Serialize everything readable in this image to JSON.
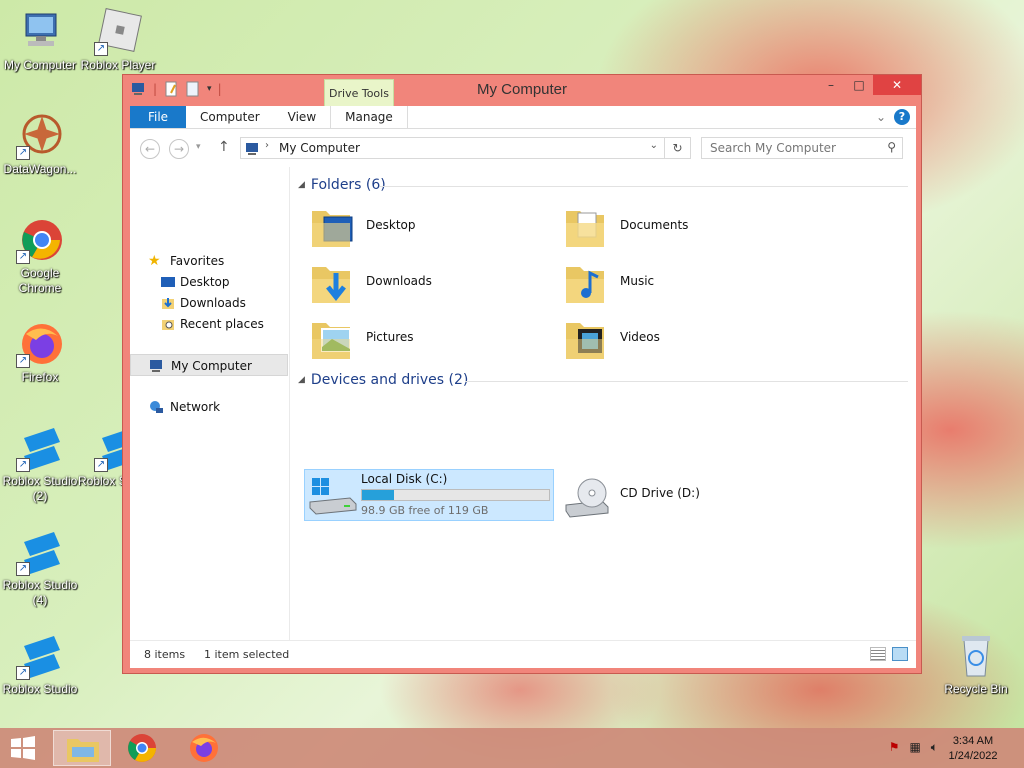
{
  "desktop": {
    "icons": [
      {
        "label": "My Computer"
      },
      {
        "label": "Roblox Player"
      },
      {
        "label": "DataWagon..."
      },
      {
        "label": "Google Chrome"
      },
      {
        "label": "Firefox"
      },
      {
        "label": "Roblox Studio (2)"
      },
      {
        "label": "Roblox S... (3)"
      },
      {
        "label": "Roblox Studio (4)"
      },
      {
        "label": "Roblox Studio"
      },
      {
        "label": "Recycle Bin"
      }
    ]
  },
  "window": {
    "title": "My Computer",
    "contextual_tab": "Drive Tools",
    "tabs": [
      "File",
      "Computer",
      "View",
      "Manage"
    ],
    "address": "My Computer",
    "search_placeholder": "Search My Computer",
    "nav": {
      "favorites": "Favorites",
      "desktop": "Desktop",
      "downloads": "Downloads",
      "recent": "Recent places",
      "my_computer": "My Computer",
      "network": "Network"
    },
    "folders_header": "Folders (6)",
    "folders": [
      "Desktop",
      "Documents",
      "Downloads",
      "Music",
      "Pictures",
      "Videos"
    ],
    "devices_header": "Devices and drives (2)",
    "drives": {
      "c_name": "Local Disk (C:)",
      "c_free": "98.9 GB free of 119 GB",
      "c_used_fraction": 0.17,
      "d_name": "CD Drive (D:)"
    },
    "status": {
      "items": "8 items",
      "selected": "1 item selected"
    }
  },
  "taskbar": {
    "time": "3:34 AM",
    "date": "1/24/2022"
  }
}
